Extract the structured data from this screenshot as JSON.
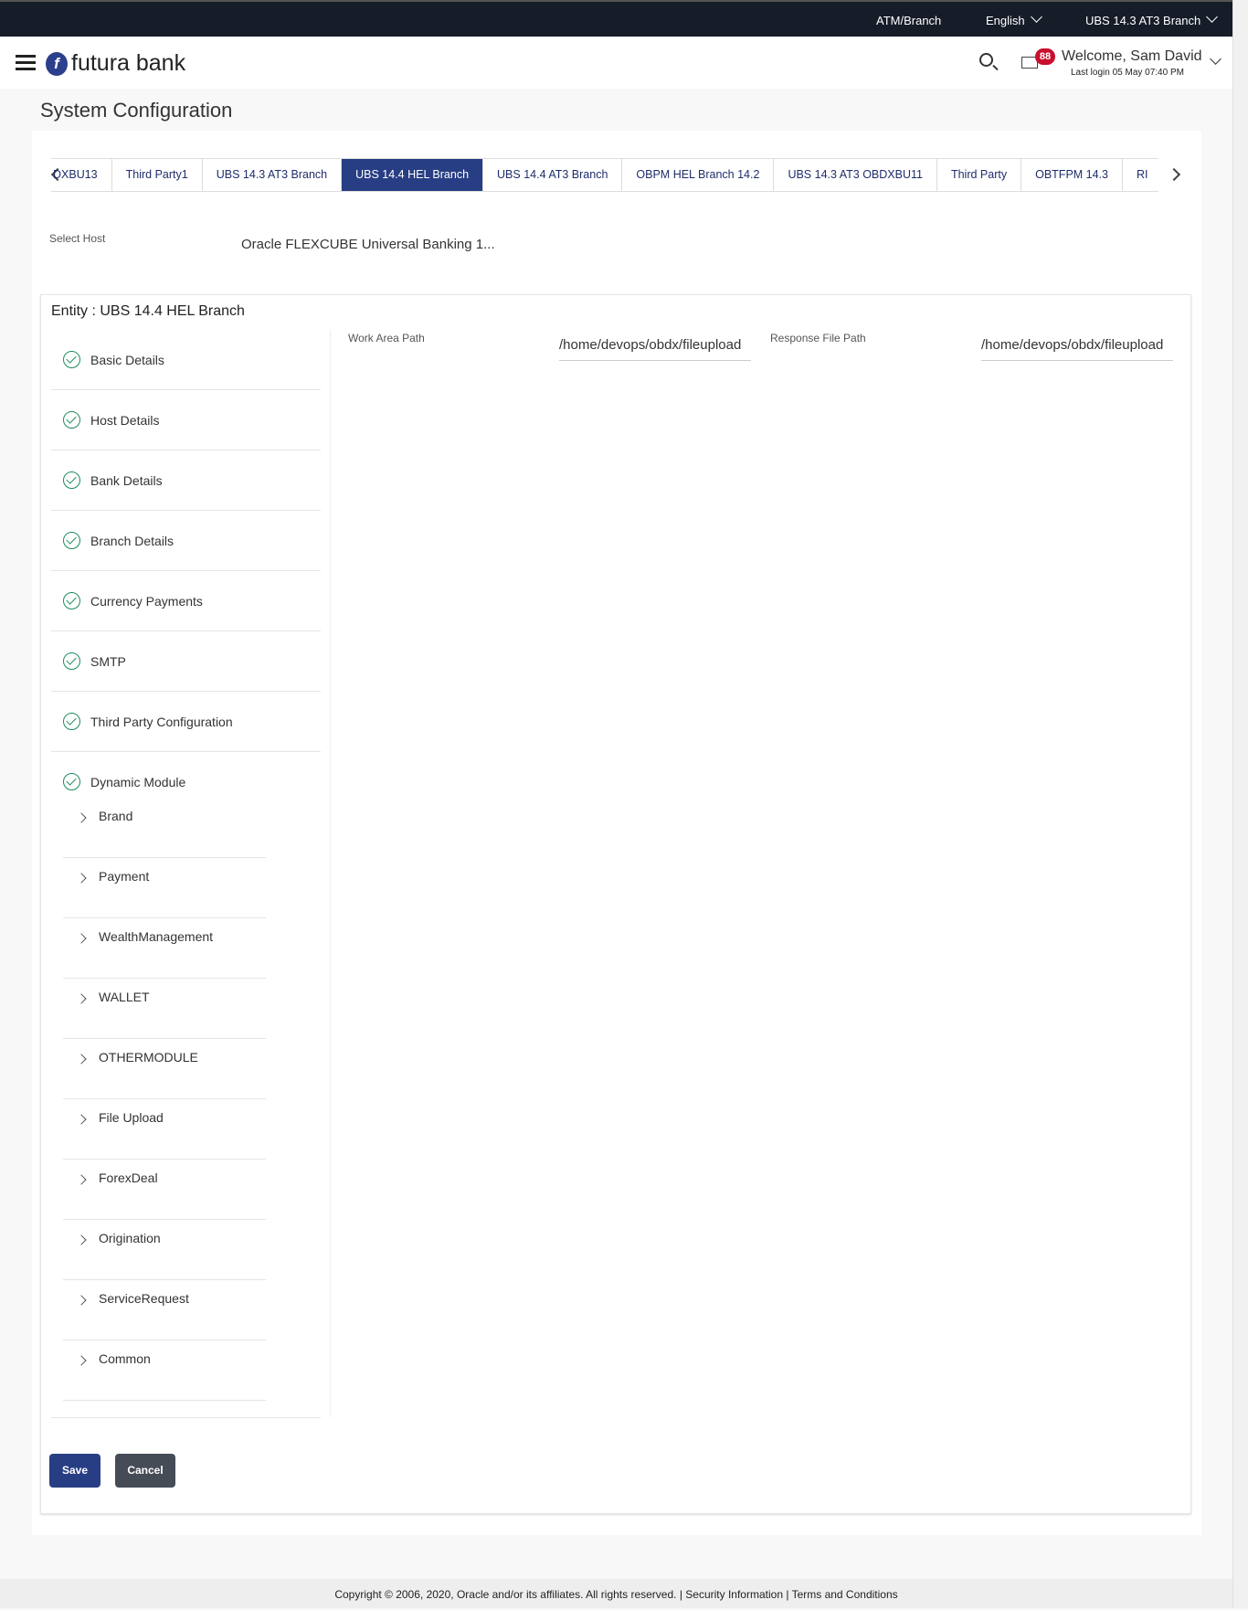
{
  "topbar": {
    "atm_branch": "ATM/Branch",
    "language": "English",
    "entity": "UBS 14.3 AT3 Branch"
  },
  "header": {
    "brand": "futura bank",
    "logo_letter": "f",
    "notifications": "88",
    "welcome": "Welcome, Sam David",
    "last_login": "Last login 05 May 07:40 PM"
  },
  "page": {
    "title": "System Configuration"
  },
  "tabs": [
    {
      "label": "DXBU13",
      "active": false
    },
    {
      "label": "Third Party1",
      "active": false
    },
    {
      "label": "UBS 14.3 AT3 Branch",
      "active": false
    },
    {
      "label": "UBS 14.4 HEL Branch",
      "active": true
    },
    {
      "label": "UBS 14.4 AT3 Branch",
      "active": false
    },
    {
      "label": "OBPM HEL Branch 14.2",
      "active": false
    },
    {
      "label": "UBS 14.3 AT3 OBDXBU11",
      "active": false
    },
    {
      "label": "Third Party",
      "active": false
    },
    {
      "label": "OBTFPM 14.3",
      "active": false
    },
    {
      "label": "RI",
      "active": false
    }
  ],
  "host": {
    "label": "Select Host",
    "value": "Oracle FLEXCUBE Universal Banking 1..."
  },
  "entity": {
    "title": "Entity : UBS 14.4 HEL Branch"
  },
  "nav": [
    "Basic Details",
    "Host Details",
    "Bank Details",
    "Branch Details",
    "Currency Payments",
    "SMTP",
    "Third Party Configuration",
    "Dynamic Module"
  ],
  "sub_nav": [
    "Brand",
    "Payment",
    "WealthManagement",
    "WALLET",
    "OTHERMODULE",
    "File Upload",
    "ForexDeal",
    "Origination",
    "ServiceRequest",
    "Common"
  ],
  "fields": {
    "work_area_label": "Work Area Path",
    "work_area_value": "/home/devops/obdx/fileupload",
    "response_label": "Response File Path",
    "response_value": "/home/devops/obdx/fileupload"
  },
  "buttons": {
    "save": "Save",
    "cancel": "Cancel"
  },
  "footer": {
    "copyright": "Copyright © 2006, 2020, Oracle and/or its affiliates. All rights reserved. | ",
    "security": "Security Information",
    "sep": " | ",
    "terms": "Terms and Conditions"
  },
  "colors": {
    "primary": "#283e84",
    "topbar": "#161c28",
    "success": "#1c8b5c",
    "badge": "#c8102e"
  }
}
